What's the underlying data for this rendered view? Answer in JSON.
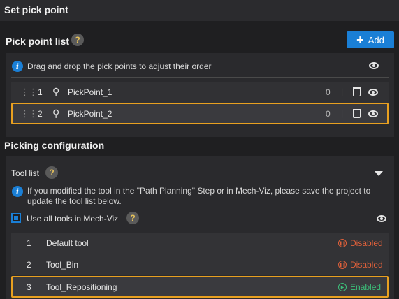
{
  "header": {
    "title": "Set pick point"
  },
  "pick_point_list": {
    "heading": "Pick point list",
    "help": "?",
    "add_label": "Add",
    "hint": "Drag and drop the pick points to adjust their order",
    "items": [
      {
        "index": "1",
        "name": "PickPoint_1",
        "count": "0",
        "selected": false
      },
      {
        "index": "2",
        "name": "PickPoint_2",
        "count": "0",
        "selected": true
      }
    ]
  },
  "picking_configuration": {
    "heading": "Picking configuration",
    "tool_list_label": "Tool list",
    "help": "?",
    "notice_line1": "If you modified the tool in the \"Path Planning\" Step or in Mech-Viz, please save the project to",
    "notice_line2": "update the tool list below.",
    "use_all_tools_label": "Use all tools in Mech-Viz",
    "use_all_tools_checked": true,
    "tools": [
      {
        "index": "1",
        "name": "Default tool",
        "status": "Disabled"
      },
      {
        "index": "2",
        "name": "Tool_Bin",
        "status": "Disabled"
      },
      {
        "index": "3",
        "name": "Tool_Repositioning",
        "status": "Enabled"
      }
    ]
  },
  "colors": {
    "accent": "#1a7fd6",
    "selected_border": "#e8a020",
    "disabled": "#e0603a",
    "enabled": "#3cc07a"
  }
}
